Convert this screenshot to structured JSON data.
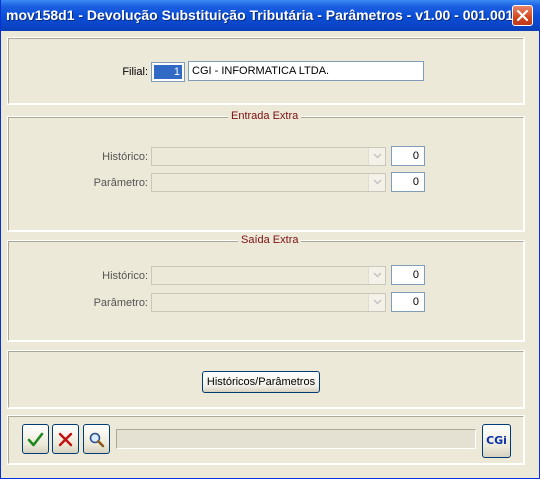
{
  "window": {
    "title": "mov158d1 - Devolução Substituição Tributária - Parâmetros - v1.00 - 001.001 ...",
    "close_icon": "close-icon"
  },
  "filial": {
    "label": "Filial:",
    "code": "1",
    "name": "CGI - INFORMATICA LTDA."
  },
  "entrada_extra": {
    "title": "Entrada Extra",
    "historico_label": "Histórico:",
    "historico_value": "0",
    "parametro_label": "Parâmetro:",
    "parametro_value": "0"
  },
  "saida_extra": {
    "title": "Saída Extra",
    "historico_label": "Histórico:",
    "historico_value": "0",
    "parametro_label": "Parâmetro:",
    "parametro_value": "0"
  },
  "actions": {
    "historicos_parametros_label": "Históricos/Parâmetros"
  },
  "toolbar": {
    "confirm_icon": "check-icon",
    "cancel_icon": "x-icon",
    "search_icon": "magnifier-icon",
    "logo_text": "CGi"
  },
  "colors": {
    "title_bar": "#0a4fd8",
    "legend_text": "#7a1010",
    "selection": "#316ac5",
    "confirm_green": "#1e8a1e",
    "cancel_red": "#c01010"
  }
}
